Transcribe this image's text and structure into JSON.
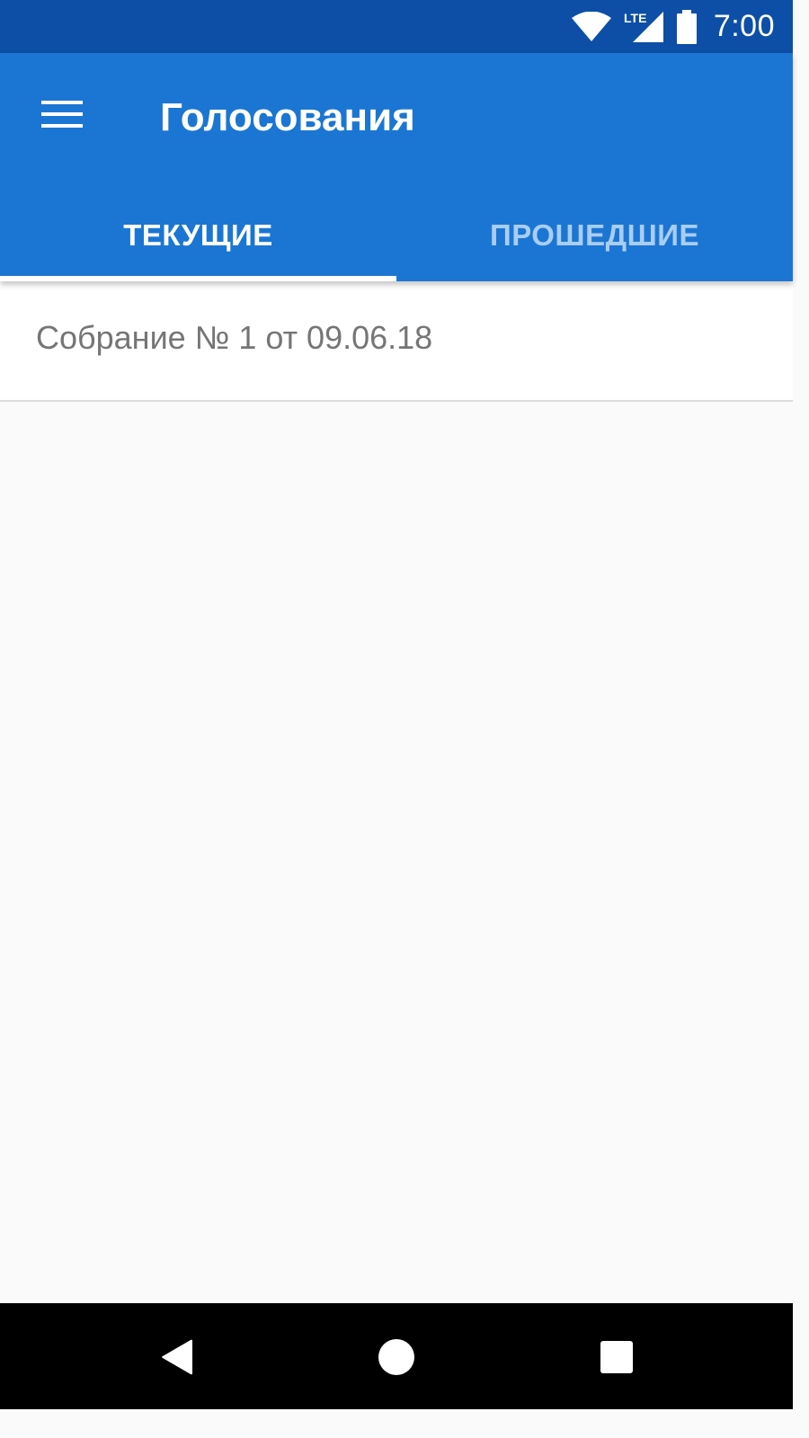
{
  "status_bar": {
    "time": "7:00",
    "network_label": "LTE",
    "icons": [
      "wifi-icon",
      "lte-signal-icon",
      "battery-icon"
    ]
  },
  "app_bar": {
    "title": "Голосования",
    "menu_icon": "hamburger-menu-icon"
  },
  "tabs": [
    {
      "label": "ТЕКУЩИЕ",
      "active": true
    },
    {
      "label": "ПРОШЕДШИЕ",
      "active": false
    }
  ],
  "list": {
    "items": [
      {
        "label": "Собрание № 1 от 09.06.18"
      }
    ]
  },
  "nav_bar": {
    "icons": [
      "back-icon",
      "home-icon",
      "recents-icon"
    ]
  },
  "colors": {
    "status_bar": "#0d4fa6",
    "primary": "#1b76d3",
    "tab_inactive_text": "#a9cdf3",
    "list_text": "#757575",
    "background": "#fafafa"
  }
}
